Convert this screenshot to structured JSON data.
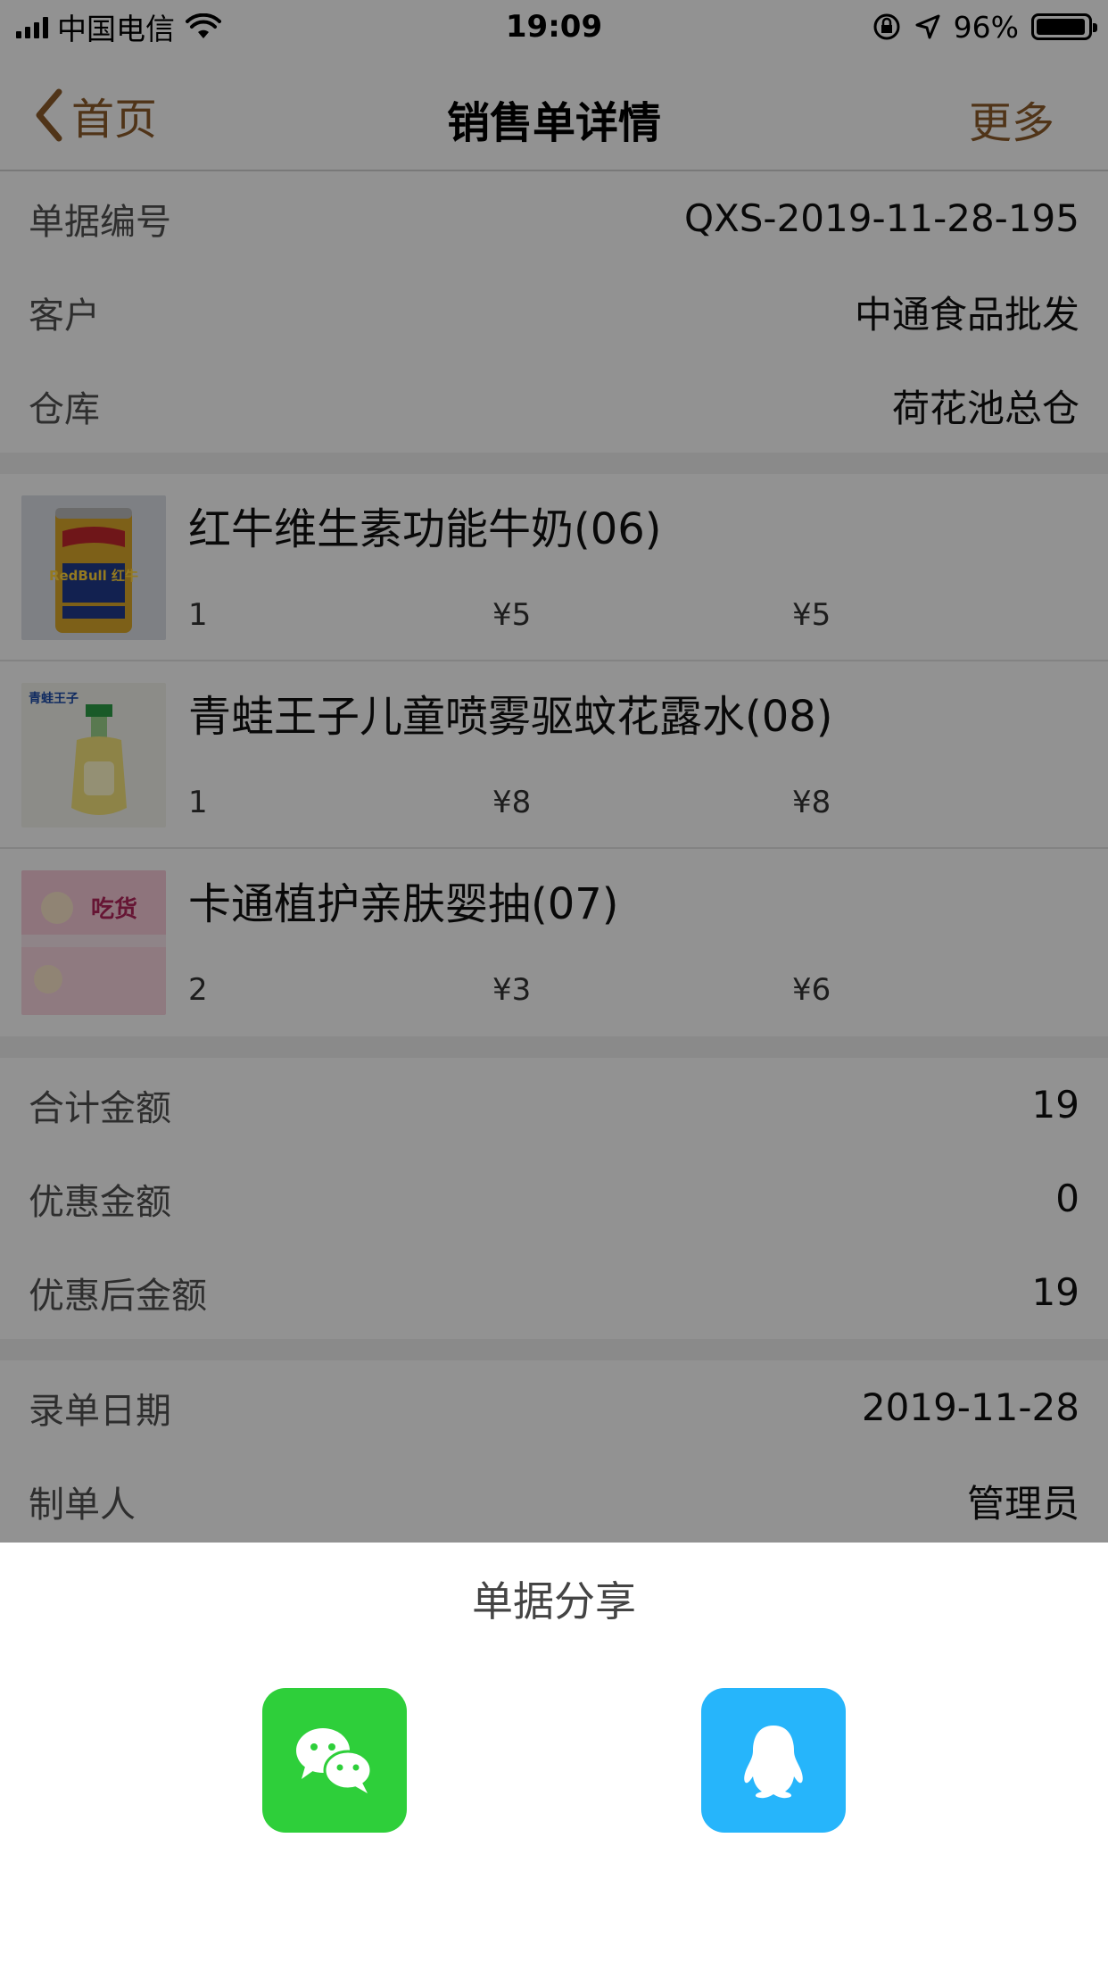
{
  "status_bar": {
    "carrier": "中国电信",
    "time": "19:09",
    "battery_percent": "96%",
    "battery_level": 0.96
  },
  "nav": {
    "back_label": "首页",
    "title": "销售单详情",
    "more_label": "更多"
  },
  "order_info": {
    "number_label": "单据编号",
    "number_value": "QXS-2019-11-28-195",
    "customer_label": "客户",
    "customer_value": "中通食品批发",
    "warehouse_label": "仓库",
    "warehouse_value": "荷花池总仓"
  },
  "products": [
    {
      "name": "红牛维生素功能牛奶(06)",
      "qty": "1",
      "price": "¥5",
      "total": "¥5",
      "image_icon": "redbull-can-photo",
      "image_text": "RedBull 红牛"
    },
    {
      "name": "青蛙王子儿童喷雾驱蚊花露水(08)",
      "qty": "1",
      "price": "¥8",
      "total": "¥8",
      "image_icon": "spray-bottle-photo",
      "image_text": "青蛙王子"
    },
    {
      "name": "卡通植护亲肤婴抽(07)",
      "qty": "2",
      "price": "¥3",
      "total": "¥6",
      "image_icon": "tissue-pack-photo",
      "image_text": "吃货"
    }
  ],
  "amounts": {
    "total_label": "合计金额",
    "total_value": "19",
    "discount_label": "优惠金额",
    "discount_value": "0",
    "after_label": "优惠后金额",
    "after_value": "19"
  },
  "meta": {
    "date_label": "录单日期",
    "date_value": "2019-11-28",
    "maker_label": "制单人",
    "maker_value": "管理员"
  },
  "share_sheet": {
    "title": "单据分享",
    "wechat_icon": "wechat-icon",
    "qq_icon": "qq-icon"
  },
  "colors": {
    "accent_brown": "#8a5a2a",
    "wechat_green": "#2ecf3a",
    "qq_blue": "#26b5fb"
  }
}
